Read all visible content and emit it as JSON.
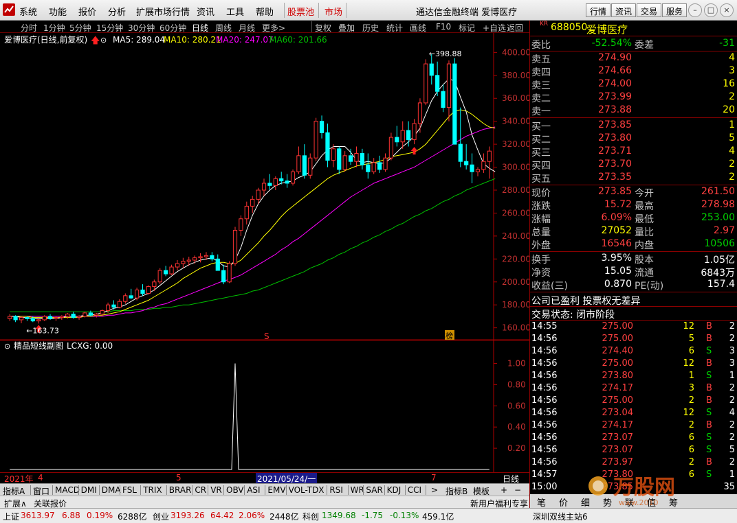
{
  "menu": {
    "items": [
      "系统",
      "功能",
      "报价",
      "分析",
      "扩展市场行情",
      "资讯",
      "工具",
      "帮助"
    ],
    "red_items": [
      "股票池",
      "市场"
    ],
    "window_title": "通达信金融终端  爱博医疗",
    "right_buttons": [
      "行情",
      "资讯",
      "交易",
      "服务"
    ]
  },
  "toolbar": {
    "periods": [
      "分时",
      "1分钟",
      "5分钟",
      "15分钟",
      "30分钟",
      "60分钟",
      "日线",
      "周线",
      "月线",
      "更多>"
    ],
    "tools": [
      "复权",
      "叠加",
      "历史",
      "统计",
      "画线",
      "F10",
      "标记",
      "+自选",
      "返回"
    ]
  },
  "main_chart": {
    "title": "爱博医疗(日线,前复权)",
    "ma5_label": "MA5: 289.04",
    "ma10_label": "MA10: 280.21",
    "ma20_label": "MA20: 247.07",
    "ma60_label": "MA60: 201.66",
    "high_label": "398.88",
    "low_label": "163.73",
    "marker_s": "S",
    "marker_bang": "榜"
  },
  "sub_chart": {
    "title": "精品短线副图",
    "value_label": "LCXG: 0.00"
  },
  "date_axis": {
    "year": "2021年",
    "m4": "4",
    "m5": "5",
    "m7": "7",
    "cursor_date": "2021/05/24/一",
    "period": "日线"
  },
  "indicator_tabs": [
    "指标A",
    "窗口",
    "MACD",
    "DMI",
    "DMA",
    "FSL",
    "TRIX",
    "BRAR",
    "CR",
    "VR",
    "OBV",
    "ASI",
    "EMV",
    "VOL-TDX",
    "RSI",
    "WR",
    "SAR",
    "KDJ",
    "CCI"
  ],
  "indicator_right": [
    "指标B",
    "模板"
  ],
  "link_tabs": [
    "扩展∧",
    "关联报价"
  ],
  "stock": {
    "badge": "KR",
    "code": "688050",
    "name": "爱博医疗",
    "wei_bi_label": "委比",
    "wei_bi": "-52.54%",
    "wei_cha_label": "委差",
    "wei_cha": "-31"
  },
  "asks": [
    {
      "label": "卖五",
      "price": "274.90",
      "vol": "4"
    },
    {
      "label": "卖四",
      "price": "274.66",
      "vol": "3"
    },
    {
      "label": "卖三",
      "price": "274.00",
      "vol": "16"
    },
    {
      "label": "卖二",
      "price": "273.99",
      "vol": "2"
    },
    {
      "label": "卖一",
      "price": "273.88",
      "vol": "20"
    }
  ],
  "bids": [
    {
      "label": "买一",
      "price": "273.85",
      "vol": "1"
    },
    {
      "label": "买二",
      "price": "273.80",
      "vol": "5"
    },
    {
      "label": "买三",
      "price": "273.71",
      "vol": "4"
    },
    {
      "label": "买四",
      "price": "273.70",
      "vol": "2"
    },
    {
      "label": "买五",
      "price": "273.35",
      "vol": "2"
    }
  ],
  "quote": [
    {
      "l1": "现价",
      "v1": "273.85",
      "c1": "red",
      "l2": "今开",
      "v2": "261.50",
      "c2": "red"
    },
    {
      "l1": "涨跌",
      "v1": "15.72",
      "c1": "red",
      "l2": "最高",
      "v2": "278.98",
      "c2": "red"
    },
    {
      "l1": "涨幅",
      "v1": "6.09%",
      "c1": "red",
      "l2": "最低",
      "v2": "253.00",
      "c2": "grn"
    },
    {
      "l1": "总量",
      "v1": "27052",
      "c1": "yel",
      "l2": "量比",
      "v2": "2.97",
      "c2": "red"
    },
    {
      "l1": "外盘",
      "v1": "16546",
      "c1": "red",
      "l2": "内盘",
      "v2": "10506",
      "c2": "grn"
    }
  ],
  "fundamentals": [
    {
      "l1": "换手",
      "v1": "3.95%",
      "l2": "股本",
      "v2": "1.05亿"
    },
    {
      "l1": "净资",
      "v1": "15.05",
      "l2": "流通",
      "v2": "6843万"
    },
    {
      "l1": "收益(三)",
      "v1": "0.870",
      "l2": "PE(动)",
      "v2": "157.4"
    }
  ],
  "notices": [
    "公司已盈利 投票权无差异",
    "交易状态: 闭市阶段"
  ],
  "ticks": [
    {
      "t": "14:55",
      "p": "275.00",
      "v": "12",
      "d": "B",
      "n": "2"
    },
    {
      "t": "14:56",
      "p": "275.00",
      "v": "5",
      "d": "B",
      "n": "2"
    },
    {
      "t": "14:56",
      "p": "274.40",
      "v": "6",
      "d": "S",
      "n": "3"
    },
    {
      "t": "14:56",
      "p": "275.00",
      "v": "12",
      "d": "B",
      "n": "3"
    },
    {
      "t": "14:56",
      "p": "273.80",
      "v": "1",
      "d": "S",
      "n": "1"
    },
    {
      "t": "14:56",
      "p": "274.17",
      "v": "3",
      "d": "B",
      "n": "2"
    },
    {
      "t": "14:56",
      "p": "275.00",
      "v": "2",
      "d": "B",
      "n": "2"
    },
    {
      "t": "14:56",
      "p": "273.04",
      "v": "12",
      "d": "S",
      "n": "4"
    },
    {
      "t": "14:56",
      "p": "274.17",
      "v": "2",
      "d": "B",
      "n": "2"
    },
    {
      "t": "14:56",
      "p": "273.07",
      "v": "6",
      "d": "S",
      "n": "2"
    },
    {
      "t": "14:56",
      "p": "273.07",
      "v": "6",
      "d": "S",
      "n": "5"
    },
    {
      "t": "14:56",
      "p": "273.97",
      "v": "2",
      "d": "B",
      "n": "2"
    },
    {
      "t": "14:57",
      "p": "273.80",
      "v": "6",
      "d": "S",
      "n": "1"
    },
    {
      "t": "15:00",
      "p": "273.85",
      "v": "",
      "d": "",
      "n": "35"
    }
  ],
  "right_tabs": [
    "笔",
    "价",
    "细",
    "势",
    "联",
    "值",
    "筹"
  ],
  "status": {
    "sh_label": "上证",
    "sh_val": "3613.97",
    "sh_chg": "6.88",
    "sh_pct": "0.19%",
    "sh_amt": "6288亿",
    "cy_label": "创业",
    "cy_val": "3193.26",
    "cy_chg": "64.42",
    "cy_pct": "2.06%",
    "cy_amt": "2448亿",
    "kc_label": "科创",
    "kc_val": "1349.68",
    "kc_chg": "-1.75",
    "kc_pct": "-0.13%",
    "kc_amt": "459.1亿",
    "promo": "新用户福利专享",
    "server": "深圳双线主站6"
  },
  "watermark": {
    "brand": "万股网",
    "url": "www.2010"
  },
  "colors": {
    "up": "#ff3333",
    "down": "#00ffff",
    "ma5": "#ffffff",
    "ma10": "#ffff00",
    "ma20": "#ff00ff",
    "ma60": "#00c000",
    "grid": "#8b0000"
  },
  "chart_data": {
    "type": "candlestick",
    "ylim": [
      155,
      405
    ],
    "yticks": [
      160,
      180,
      200,
      220,
      240,
      260,
      280,
      300,
      320,
      340,
      360,
      380,
      400
    ],
    "sub_ylim": [
      0,
      1.1
    ],
    "sub_yticks": [
      0.2,
      0.4,
      0.6,
      0.8,
      1.0
    ],
    "candles": [
      [
        168,
        172,
        166,
        170
      ],
      [
        170,
        171,
        165,
        167
      ],
      [
        167,
        170,
        164,
        169
      ],
      [
        169,
        170,
        166,
        168
      ],
      [
        168,
        170,
        165,
        166
      ],
      [
        166,
        168,
        163.73,
        167
      ],
      [
        167,
        171,
        166,
        170
      ],
      [
        170,
        172,
        167,
        168
      ],
      [
        168,
        170,
        166,
        169
      ],
      [
        169,
        171,
        167,
        170
      ],
      [
        170,
        173,
        168,
        172
      ],
      [
        172,
        174,
        168,
        169
      ],
      [
        169,
        171,
        167,
        170
      ],
      [
        170,
        174,
        169,
        173
      ],
      [
        173,
        175,
        170,
        171
      ],
      [
        171,
        173,
        169,
        172
      ],
      [
        172,
        176,
        170,
        175
      ],
      [
        175,
        182,
        173,
        180
      ],
      [
        180,
        184,
        176,
        178
      ],
      [
        178,
        185,
        177,
        183
      ],
      [
        183,
        190,
        181,
        188
      ],
      [
        188,
        194,
        185,
        186
      ],
      [
        186,
        195,
        184,
        193
      ],
      [
        193,
        198,
        188,
        190
      ],
      [
        190,
        197,
        189,
        196
      ],
      [
        196,
        202,
        192,
        200
      ],
      [
        200,
        212,
        198,
        210
      ],
      [
        210,
        214,
        205,
        207
      ],
      [
        207,
        215,
        206,
        213
      ],
      [
        213,
        219,
        210,
        216
      ],
      [
        216,
        221,
        212,
        218
      ],
      [
        218,
        222,
        214,
        219
      ],
      [
        219,
        223,
        216,
        221
      ],
      [
        221,
        225,
        217,
        222
      ],
      [
        222,
        226,
        219,
        223
      ],
      [
        223,
        226,
        218,
        220
      ],
      [
        220,
        224,
        216,
        210
      ],
      [
        210,
        215,
        198,
        200
      ],
      [
        200,
        218,
        199,
        216
      ],
      [
        216,
        248,
        214,
        245
      ],
      [
        245,
        258,
        240,
        255
      ],
      [
        255,
        270,
        250,
        266
      ],
      [
        266,
        275,
        260,
        272
      ],
      [
        272,
        282,
        268,
        280
      ],
      [
        280,
        290,
        275,
        286
      ],
      [
        286,
        294,
        280,
        284
      ],
      [
        284,
        292,
        280,
        290
      ],
      [
        290,
        296,
        285,
        288
      ],
      [
        288,
        294,
        282,
        286
      ],
      [
        286,
        298,
        284,
        296
      ],
      [
        296,
        318,
        294,
        310
      ],
      [
        310,
        320,
        290,
        293
      ],
      [
        293,
        312,
        290,
        308
      ],
      [
        308,
        343,
        305,
        340
      ],
      [
        340,
        345,
        325,
        330
      ],
      [
        330,
        338,
        300,
        306
      ],
      [
        306,
        320,
        300,
        316
      ],
      [
        316,
        318,
        294,
        298
      ],
      [
        298,
        314,
        296,
        310
      ],
      [
        310,
        316,
        302,
        305
      ],
      [
        305,
        318,
        300,
        312
      ],
      [
        312,
        316,
        298,
        302
      ],
      [
        302,
        312,
        290,
        296
      ],
      [
        296,
        308,
        294,
        304
      ],
      [
        304,
        310,
        295,
        298
      ],
      [
        298,
        312,
        296,
        308
      ],
      [
        308,
        330,
        306,
        326
      ],
      [
        326,
        336,
        318,
        322
      ],
      [
        322,
        340,
        316,
        332
      ],
      [
        332,
        340,
        318,
        324
      ],
      [
        324,
        342,
        320,
        338
      ],
      [
        338,
        360,
        330,
        356
      ],
      [
        356,
        394,
        354,
        390
      ],
      [
        390,
        398.88,
        372,
        380
      ],
      [
        380,
        392,
        362,
        366
      ],
      [
        366,
        372,
        348,
        352
      ],
      [
        352,
        393,
        340,
        390
      ],
      [
        390,
        395,
        320,
        320
      ],
      [
        320,
        352,
        300,
        305
      ],
      [
        305,
        320,
        298,
        302
      ],
      [
        302,
        312,
        286,
        296
      ],
      [
        296,
        300,
        292,
        298
      ],
      [
        298,
        312,
        295,
        305
      ],
      [
        305,
        318,
        290,
        314
      ]
    ],
    "ma5": [
      170,
      170,
      169,
      169,
      168,
      168,
      168,
      168,
      168,
      169,
      170,
      170,
      170,
      171,
      171,
      172,
      173,
      175,
      177,
      178,
      180,
      183,
      186,
      188,
      190,
      193,
      197,
      201,
      205,
      209,
      212,
      215,
      217,
      219,
      220,
      221,
      218,
      214,
      213,
      219,
      230,
      245,
      258,
      268,
      275,
      280,
      284,
      286,
      287,
      288,
      291,
      293,
      296,
      303,
      310,
      315,
      318,
      318,
      318,
      313,
      306,
      304,
      305,
      304,
      303,
      304,
      308,
      313,
      318,
      322,
      327,
      334,
      346,
      358,
      366,
      372,
      377,
      375,
      361,
      348,
      328,
      315,
      303,
      299,
      296
    ],
    "ma10": [
      170,
      170,
      170,
      170,
      169,
      169,
      169,
      169,
      169,
      169,
      169,
      169,
      169,
      170,
      170,
      171,
      171,
      172,
      173,
      174,
      176,
      178,
      180,
      182,
      184,
      187,
      190,
      193,
      196,
      199,
      203,
      206,
      209,
      212,
      214,
      216,
      217,
      217,
      216,
      216,
      219,
      224,
      229,
      234,
      240,
      245,
      251,
      257,
      262,
      266,
      270,
      274,
      278,
      282,
      286,
      290,
      293,
      295,
      297,
      299,
      301,
      302,
      303,
      304,
      305,
      307,
      309,
      310,
      311,
      312,
      313,
      316,
      320,
      326,
      332,
      338,
      344,
      349,
      350,
      349,
      346,
      342,
      338,
      335,
      334
    ],
    "ma20": [
      170,
      170,
      170,
      170,
      170,
      170,
      170,
      170,
      170,
      170,
      170,
      170,
      170,
      170,
      170,
      170,
      170,
      171,
      171,
      172,
      173,
      173,
      174,
      175,
      177,
      178,
      180,
      181,
      183,
      185,
      187,
      189,
      191,
      193,
      195,
      197,
      199,
      201,
      202,
      204,
      206,
      209,
      212,
      215,
      218,
      221,
      224,
      228,
      231,
      235,
      238,
      242,
      246,
      250,
      254,
      258,
      262,
      266,
      270,
      274,
      277,
      280,
      283,
      286,
      288,
      290,
      292,
      294,
      296,
      298,
      300,
      303,
      306,
      309,
      312,
      315,
      318,
      321,
      324,
      327,
      329,
      331,
      333,
      334,
      335
    ],
    "ma60": [
      174,
      174,
      174,
      174,
      174,
      174,
      174,
      174,
      174,
      174,
      174,
      174,
      174,
      174,
      174,
      174,
      174,
      174,
      175,
      175,
      175,
      175,
      176,
      176,
      176,
      177,
      177,
      178,
      178,
      179,
      180,
      180,
      181,
      182,
      183,
      184,
      185,
      186,
      187,
      188,
      189,
      190,
      192,
      193,
      195,
      197,
      199,
      201,
      203,
      205,
      207,
      209,
      212,
      214,
      216,
      219,
      221,
      224,
      226,
      229,
      231,
      234,
      236,
      239,
      241,
      244,
      246,
      249,
      251,
      254,
      257,
      259,
      262,
      264,
      267,
      270,
      272,
      275,
      277,
      280,
      282,
      284,
      286,
      288,
      290
    ],
    "lcxg_peak_index": 39
  }
}
